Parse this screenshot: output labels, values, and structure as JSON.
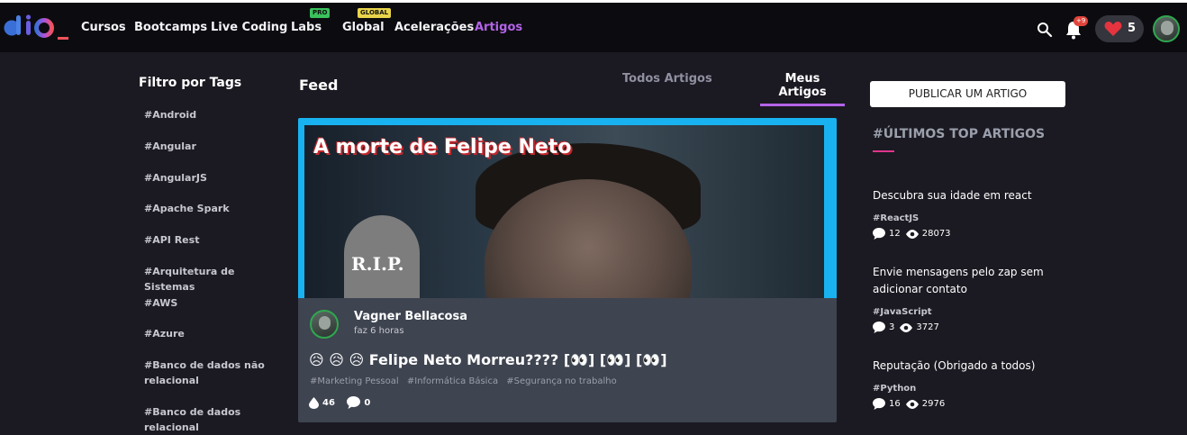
{
  "brand": {
    "logo_alt": "dio_"
  },
  "nav": {
    "items": [
      {
        "label": "Cursos"
      },
      {
        "label": "Bootcamps"
      },
      {
        "label": "Live Coding"
      },
      {
        "label": "Labs",
        "badge": "PRO"
      },
      {
        "label": "Global",
        "badge": "GLOBAL"
      },
      {
        "label": "Acelerações"
      },
      {
        "label": "Artigos",
        "active": true
      }
    ]
  },
  "header": {
    "notifications_count": "+9",
    "likes_count": "5",
    "icons": [
      "search-icon",
      "bell-icon",
      "heart-icon",
      "user-avatar"
    ]
  },
  "sidebar": {
    "title": "Filtro por Tags",
    "tags": [
      "#Android",
      "#Angular",
      "#AngularJS",
      "#Apache Spark",
      "#API Rest",
      "#Arquitetura de Sistemas",
      "#AWS",
      "#Azure",
      "#Banco de dados não relacional",
      "#Banco de dados relacional"
    ]
  },
  "feed": {
    "title": "Feed",
    "tabs": [
      "Todos Artigos",
      "Meus Artigos"
    ],
    "active_tab": "Meus Artigos",
    "post": {
      "thumbnail_title": "A morte de Felipe Neto",
      "thumbnail_tomb": "R.I.P.",
      "author": "Vagner Bellacosa",
      "time": "faz 6 horas",
      "title": "😥 😥 😥 Felipe Neto Morreu???? [👀] [👀] [👀]",
      "tags": [
        "#Marketing Pessoal",
        "#Informática Básica",
        "#Segurança no trabalho"
      ],
      "likes": "46",
      "comments": "0"
    }
  },
  "right": {
    "publish_label": "PUBLICAR UM ARTIGO",
    "top_title": "#ÚLTIMOS TOP ARTIGOS",
    "articles": [
      {
        "title": "Descubra sua idade em react",
        "tag": "#ReactJS",
        "comments": "12",
        "views": "28073"
      },
      {
        "title": "Envie mensagens pelo zap sem adicionar contato",
        "tag": "#JavaScript",
        "comments": "3",
        "views": "3727"
      },
      {
        "title": "Reputação (Obrigado a todos)",
        "tag": "#Python",
        "comments": "16",
        "views": "2976"
      }
    ]
  },
  "colors": {
    "accent": "#b463e9",
    "background": "#1b1a22",
    "topbar": "#0c0c10",
    "card": "#3e4450",
    "thumb_border": "#19b2f0",
    "underline_pink": "#e0348b",
    "avatar_border": "#2fa84f"
  }
}
